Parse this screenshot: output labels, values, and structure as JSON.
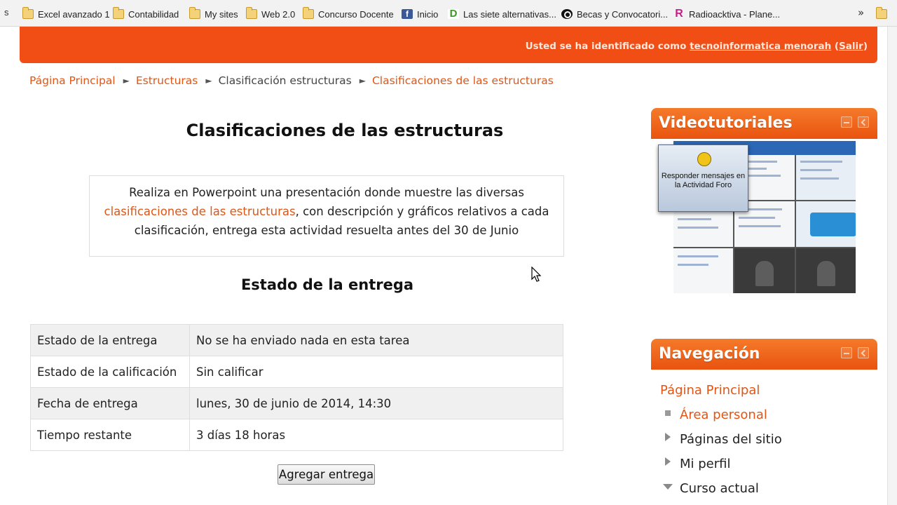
{
  "bookmarks_bar": {
    "edge_glyph": "s",
    "items": [
      {
        "label": "Excel avanzado 1",
        "icon": "folder-icon"
      },
      {
        "label": "Contabilidad",
        "icon": "folder-icon"
      },
      {
        "label": "My sites",
        "icon": "folder-icon"
      },
      {
        "label": "Web 2.0",
        "icon": "folder-icon"
      },
      {
        "label": "Concurso Docente",
        "icon": "folder-icon"
      },
      {
        "label": "Inicio",
        "icon": "facebook-icon"
      },
      {
        "label": "Las siete alternativas...",
        "icon": "d-logo-icon"
      },
      {
        "label": "Becas y Convocatori...",
        "icon": "becas-icon"
      },
      {
        "label": "Radioacktiva - Plane...",
        "icon": "radioacktiva-icon"
      }
    ],
    "more_label": "»"
  },
  "header": {
    "login_prefix": "Usted se ha identificado como ",
    "user_name": "tecnoinformatica menorah",
    "logout_open": " (",
    "logout_label": "Salir",
    "logout_close": ")",
    "brand_color": "#f04e14"
  },
  "breadcrumb": {
    "items": [
      {
        "label": "Página Principal",
        "link": true
      },
      {
        "label": "Estructuras",
        "link": true
      },
      {
        "label": "Clasificación estructuras",
        "link": false
      },
      {
        "label": "Clasificaciones de las estructuras",
        "link": true
      }
    ],
    "separator": "►"
  },
  "main": {
    "title": "Clasificaciones de las estructuras",
    "intro": {
      "part1": "Realiza en Powerpoint una presentación donde muestre las diversas ",
      "highlight": "clasificaciones de las estructuras",
      "part2": ", con descripción y gráficos relativos a cada clasificación, entrega esta actividad resuelta antes del 30 de Junio"
    },
    "status_heading": "Estado de la entrega",
    "status_rows": [
      {
        "label": "Estado de la entrega",
        "value": "No se ha enviado nada en esta tarea"
      },
      {
        "label": "Estado de la calificación",
        "value": "Sin calificar"
      },
      {
        "label": "Fecha de entrega",
        "value": "lunes, 30 de junio de 2014, 14:30"
      },
      {
        "label": "Tiempo restante",
        "value": "3 días 18 horas"
      }
    ],
    "submit_label": "Agregar entrega"
  },
  "video_block": {
    "title": "Videotutoriales",
    "overlay_text": "Responder mensajes en la Actividad Foro"
  },
  "nav_block": {
    "title": "Navegación",
    "root": "Página Principal",
    "items": [
      {
        "label": "Área personal",
        "link": true,
        "marker": "bullet"
      },
      {
        "label": "Páginas del sitio",
        "link": false,
        "marker": "collapsed"
      },
      {
        "label": "Mi perfil",
        "link": false,
        "marker": "collapsed"
      },
      {
        "label": "Curso actual",
        "link": false,
        "marker": "expanded"
      }
    ]
  },
  "colors": {
    "accent": "#e05617",
    "block_header": "#ef6320",
    "table_stripe": "#f0f0f0"
  }
}
